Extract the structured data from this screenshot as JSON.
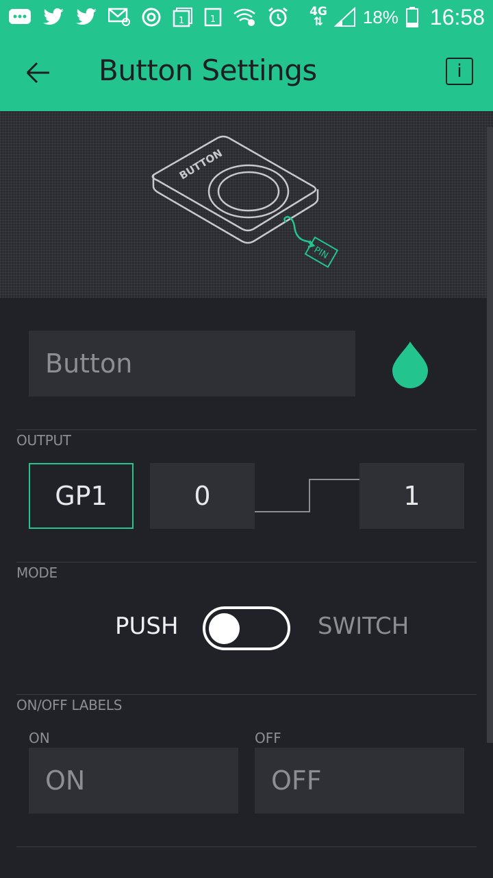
{
  "status_bar": {
    "battery": "18%",
    "time": "16:58",
    "network": "4G",
    "icons": [
      "messages-icon",
      "twitter-icon",
      "twitter-icon",
      "email-icon",
      "browser-icon",
      "calendar-icon",
      "calendar-icon",
      "wifi-icon",
      "alarm-icon",
      "signal-icon",
      "battery-icon"
    ]
  },
  "toolbar": {
    "title": "Button Settings",
    "info_label": "i"
  },
  "illustration": {
    "device_label": "BUTTON",
    "pin_label": "PIN"
  },
  "name_field": {
    "value": "Button"
  },
  "accent_color": "#23c48e",
  "output": {
    "label": "OUTPUT",
    "pin": "GP1",
    "min": "0",
    "max": "1"
  },
  "mode": {
    "label": "MODE",
    "push": "PUSH",
    "switch": "SWITCH",
    "selected": "PUSH"
  },
  "on_off_labels": {
    "label": "ON/OFF LABELS",
    "on_label": "ON",
    "off_label": "OFF",
    "on_value": "ON",
    "off_value": "OFF"
  }
}
